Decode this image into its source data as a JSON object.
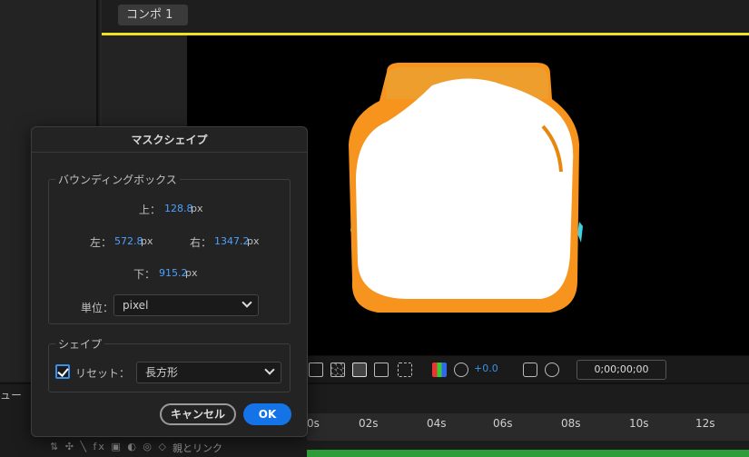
{
  "comp_tab": {
    "label": "コンポ 1"
  },
  "dialog": {
    "title": "マスクシェイプ",
    "bounding_box": {
      "label": "バウンディングボックス",
      "top_label": "上：",
      "top_value": "128.8",
      "top_unit": "px",
      "left_label": "左：",
      "left_value": "572.8",
      "left_unit": "px",
      "right_label": "右：",
      "right_value": "1347.2",
      "right_unit": "px",
      "bottom_label": "下：",
      "bottom_value": "915.2",
      "bottom_unit": "px",
      "units_label": "単位：",
      "units_value": "pixel"
    },
    "shape": {
      "label": "シェイプ",
      "reset_label": "リセット：",
      "reset_checked": true,
      "shape_value": "長方形"
    },
    "cancel_label": "キャンセル",
    "ok_label": "OK"
  },
  "control_bar": {
    "exposure": "+0.0",
    "timecode": "0;00;00;00"
  },
  "timeline": {
    "ruler": [
      "0s",
      "02s",
      "04s",
      "06s",
      "08s",
      "10s",
      "12s"
    ],
    "left_label": "ュー",
    "parent_link": "親とリンク"
  },
  "colors": {
    "accent": "#1473e6",
    "value_blue": "#4ca0ff",
    "comp_border": "#f0e020",
    "shape_orange": "#f7941d"
  }
}
